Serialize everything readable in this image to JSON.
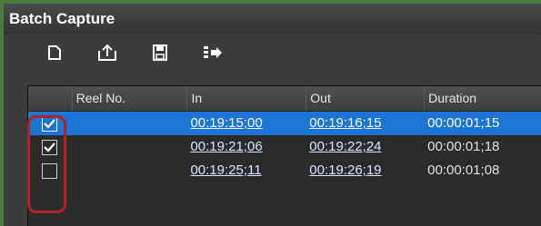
{
  "window": {
    "title": "Batch Capture"
  },
  "toolbar": {
    "buttons": [
      {
        "icon": "new-document-icon"
      },
      {
        "icon": "export-icon"
      },
      {
        "icon": "save-icon"
      },
      {
        "icon": "list-import-icon"
      }
    ]
  },
  "table": {
    "headers": {
      "reel": "Reel No.",
      "in": "In",
      "out": "Out",
      "duration": "Duration"
    },
    "rows": [
      {
        "checked": true,
        "reel": "",
        "in": "00:19:15;00",
        "out": "00:19:16;15",
        "duration": "00:00:01;15",
        "selected": true
      },
      {
        "checked": true,
        "reel": "",
        "in": "00:19:21;06",
        "out": "00:19:22;24",
        "duration": "00:00:01;18",
        "selected": false
      },
      {
        "checked": false,
        "reel": "",
        "in": "00:19:25;11",
        "out": "00:19:26;19",
        "duration": "00:00:01;08",
        "selected": false
      }
    ]
  },
  "colors": {
    "selection": "#1c74d4",
    "highlight_ring": "#b32025"
  }
}
